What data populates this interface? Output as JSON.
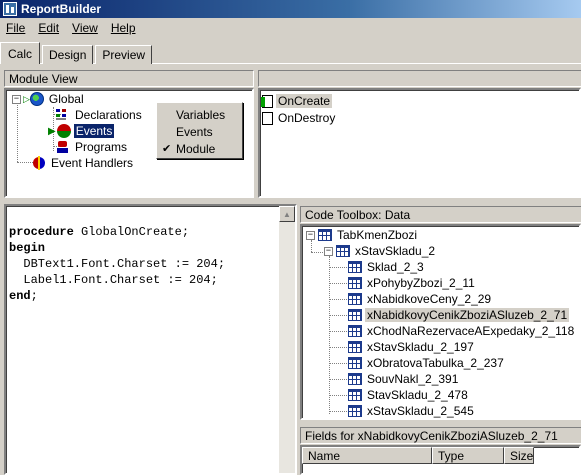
{
  "window": {
    "title": "ReportBuilder",
    "icon": "report-builder-icon"
  },
  "menu": [
    {
      "label": "File",
      "underline": "F"
    },
    {
      "label": "Edit",
      "underline": "E"
    },
    {
      "label": "View",
      "underline": "V"
    },
    {
      "label": "Help",
      "underline": "H"
    }
  ],
  "tabs": [
    "Calc",
    "Design",
    "Preview"
  ],
  "active_tab": "Calc",
  "module_view": {
    "title": "Module View",
    "tree": {
      "global": "Global",
      "declarations": "Declarations",
      "events": "Events",
      "programs": "Programs",
      "event_handlers": "Event Handlers"
    }
  },
  "popup_menu": {
    "items": [
      "Variables",
      "Events",
      "Module"
    ],
    "checked": "Module"
  },
  "events_list": {
    "items": [
      "OnCreate",
      "OnDestroy"
    ],
    "selected": "OnCreate"
  },
  "code_editor": {
    "lines": [
      {
        "kw": "procedure",
        "rest": " GlobalOnCreate;"
      },
      {
        "kw": "begin",
        "rest": ""
      },
      {
        "kw": "",
        "rest": "  DBText1.Font.Charset := 204;"
      },
      {
        "kw": "",
        "rest": "  Label1.Font.Charset := 204;"
      },
      {
        "kw": "end",
        "rest": ";"
      }
    ]
  },
  "code_toolbox": {
    "title": "Code Toolbox: Data",
    "root": "TabKmenZbozi",
    "child": "xStavSkladu_2",
    "items": [
      "Sklad_2_3",
      "xPohybyZbozi_2_11",
      "xNabidkoveCeny_2_29",
      "xNabidkovyCenikZboziASluzeb_2_71",
      "xChodNaRezervaceAExpedaky_2_118",
      "xStavSkladu_2_197",
      "xObratovaTabulka_2_237",
      "SouvNakl_2_391",
      "StavSkladu_2_478",
      "xStavSkladu_2_545"
    ],
    "selected": "xNabidkovyCenikZboziASluzeb_2_71"
  },
  "fields_panel": {
    "title": "Fields for xNabidkovyCenikZboziASluzeb_2_71",
    "columns": [
      "Name",
      "Type",
      "Size"
    ]
  }
}
